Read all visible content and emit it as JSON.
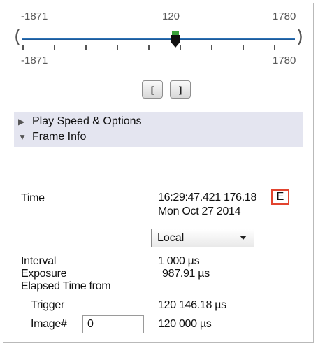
{
  "slider": {
    "min_label_top": "-1871",
    "value_label": "120",
    "max_label_top": "1780",
    "min_label_bottom": "-1871",
    "max_label_bottom": "1780",
    "min": -1871,
    "max": 1780,
    "value": 120
  },
  "buttons": {
    "set_start_label": "[",
    "set_end_label": "]"
  },
  "sections": {
    "play_speed": "Play Speed & Options",
    "frame_info": "Frame Info"
  },
  "frame_info": {
    "time_label": "Time",
    "time_value": "16:29:47.421 176.18",
    "time_suffix": "E",
    "date_value": "Mon Oct 27 2014",
    "timezone_selected": "Local",
    "interval_label": "Interval",
    "interval_value": "1 000 µs",
    "exposure_label": "Exposure",
    "exposure_value": "987.91 µs",
    "elapsed_label": "Elapsed Time from",
    "trigger_label": "Trigger",
    "trigger_value": "120 146.18 µs",
    "image_label": "Image#",
    "image_input_value": "0",
    "image_value": "120 000 µs"
  },
  "colors": {
    "track": "#2f7cc4",
    "section_bg": "#e4e5f0",
    "highlight": "#e2442f"
  },
  "icons": [
    "expand-triangle-icon",
    "collapse-triangle-icon",
    "slider-thumb-icon",
    "dropdown-arrow-icon"
  ]
}
